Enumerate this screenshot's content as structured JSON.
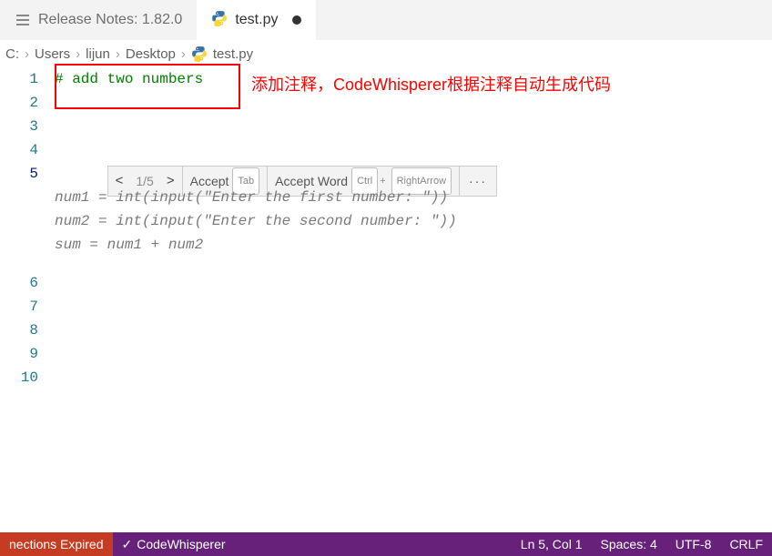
{
  "tabs": [
    {
      "label": "Release Notes: 1.82.0",
      "active": false
    },
    {
      "label": "test.py",
      "active": true,
      "dirty": true
    }
  ],
  "breadcrumbs": [
    "C:",
    "Users",
    "lijun",
    "Desktop",
    "test.py"
  ],
  "code": {
    "line1_comment": "# add two numbers",
    "ghost_line1": "num1 = int(input(\"Enter the first number: \"))",
    "ghost_line2": "num2 = int(input(\"Enter the second number: \"))",
    "ghost_line3": "sum = num1 + num2"
  },
  "line_numbers": [
    "1",
    "2",
    "3",
    "4",
    "5",
    "6",
    "7",
    "8",
    "9",
    "10"
  ],
  "current_line": 5,
  "annotation": {
    "text": "添加注释，CodeWhisperer根据注释自动生成代码"
  },
  "suggest": {
    "prev": "<",
    "count": "1/5",
    "next": ">",
    "accept": "Accept",
    "accept_key": "Tab",
    "accept_word": "Accept Word",
    "aw_key1": "Ctrl",
    "aw_plus": "+",
    "aw_key2": "RightArrow",
    "more": "···"
  },
  "status": {
    "connections": "nections Expired",
    "cw": "CodeWhisperer",
    "ln_col": "Ln 5, Col 1",
    "spaces": "Spaces: 4",
    "encoding": "UTF-8",
    "eol": "CRLF"
  }
}
